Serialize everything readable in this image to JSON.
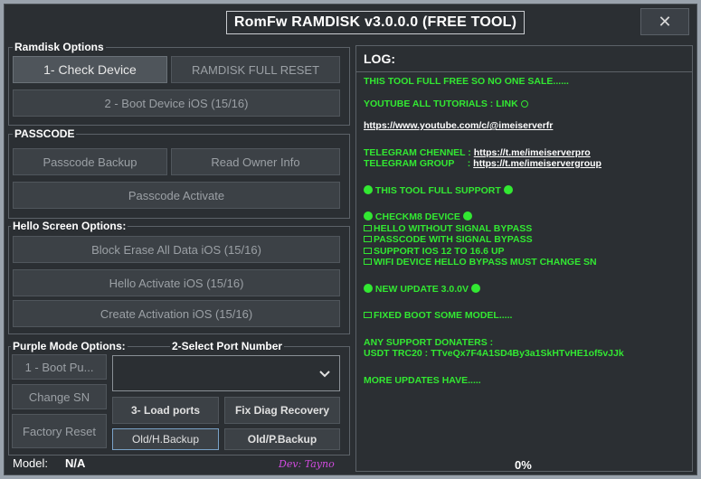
{
  "window": {
    "title": "RomFw RAMDISK v3.0.0.0 (FREE TOOL)",
    "close": "✕"
  },
  "ramdisk": {
    "label": "Ramdisk Options",
    "check_device": "1- Check Device",
    "full_reset": "RAMDISK FULL RESET",
    "boot_device": "2 - Boot Device iOS (15/16)"
  },
  "passcode": {
    "label": "PASSCODE",
    "backup": "Passcode Backup",
    "read_owner": "Read Owner Info",
    "activate": "Passcode Activate"
  },
  "hello": {
    "label": "Hello Screen Options:",
    "block_erase": "Block Erase All Data iOS (15/16)",
    "hello_activate": "Hello Activate iOS (15/16)",
    "create_activation": "Create Activation iOS (15/16)"
  },
  "purple": {
    "label": "Purple Mode Options:",
    "port_label": "2-Select Port Number",
    "boot_pu": "1 - Boot Pu...",
    "change_sn": "Change SN",
    "factory_reset": "Factory Reset",
    "load_ports": "3- Load ports",
    "fix_diag": "Fix Diag Recovery",
    "old_h_backup": "Old/H.Backup",
    "old_p_backup": "Old/P.Backup",
    "port_value": ""
  },
  "status": {
    "model_label": "Model:",
    "model_value": "N/A",
    "dev": "Dev: Tayno"
  },
  "log": {
    "title": "LOG:",
    "l1": "THIS TOOL FULL FREE SO NO ONE SALE......",
    "l2": "YOUTUBE ALL TUTORIALS : LINK",
    "l3": "https://www.youtube.com/c/@imeiserverfr",
    "l4_label": "TELEGRAM CHENNEL : ",
    "l4_link": "https://t.me/imeiserverpro",
    "l5_label": "TELEGRAM GROUP     : ",
    "l5_link": "https://t.me/imeiservergroup",
    "l6": "THIS TOOL FULL SUPPORT",
    "l7": "CHECKM8 DEVICE",
    "l8": "HELLO WITHOUT SIGNAL BYPASS",
    "l9": "PASSCODE WITH SIGNAL BYPASS",
    "l10": "SUPPORT IOS 12 TO 16.6 UP",
    "l11": "WIFI DEVICE HELLO BYPASS MUST CHANGE SN",
    "l12": "NEW UPDATE 3.0.0V",
    "l13": "FIXED BOOT SOME MODEL.....",
    "l14": "ANY SUPPORT DONATERS :",
    "l15": "USDT TRC20 : TTveQx7F4A1SD4By3a1SkHTvHE1of5vJJk",
    "l16": "MORE UPDATES HAVE.....",
    "progress": "0%"
  }
}
